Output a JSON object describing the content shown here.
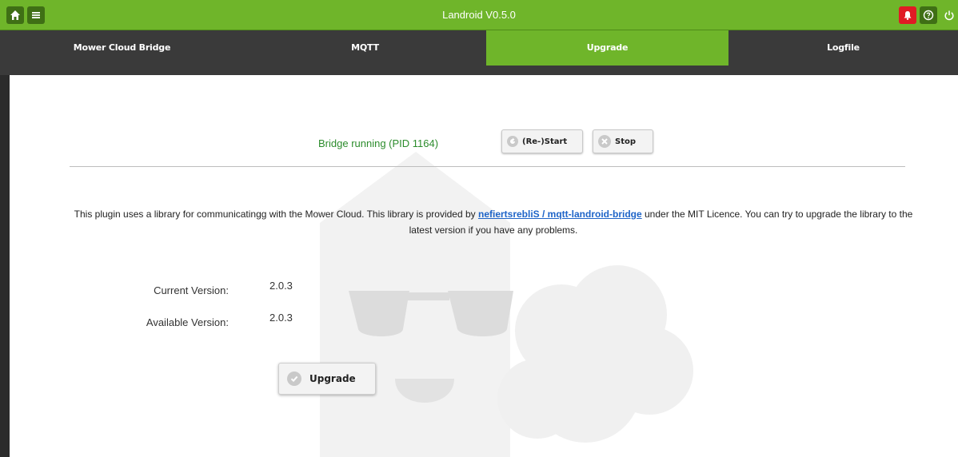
{
  "header": {
    "title": "Landroid V0.5.0",
    "icons": [
      "home-icon",
      "menu-icon",
      "bell-icon",
      "help-icon",
      "power-icon"
    ]
  },
  "tabs": [
    {
      "label": "Mower Cloud Bridge",
      "active": false
    },
    {
      "label": "MQTT",
      "active": false
    },
    {
      "label": "Upgrade",
      "active": true
    },
    {
      "label": "Logfile",
      "active": false
    }
  ],
  "bridge": {
    "status": "Bridge running (PID 1164)",
    "restart_label": "(Re-)Start",
    "stop_label": "Stop"
  },
  "info": {
    "text_before": "This plugin uses a library for communicatingg with the Mower Cloud. This library is provided by ",
    "link_text": "nefiertsrebliS / mqtt-landroid-bridge",
    "text_after": " under the MIT Licence. You can try to upgrade the library to the latest version if you have any problems."
  },
  "versions": {
    "current_label": "Current Version:",
    "current_value": "2.0.3",
    "available_label": "Available Version:",
    "available_value": "2.0.3"
  },
  "upgrade": {
    "button_label": "Upgrade"
  },
  "colors": {
    "accent": "#6fb52a",
    "tabbar": "#3a3a3a",
    "status_green": "#2c8c2c",
    "alert_red": "#e01b24",
    "link": "#1e64c8"
  }
}
